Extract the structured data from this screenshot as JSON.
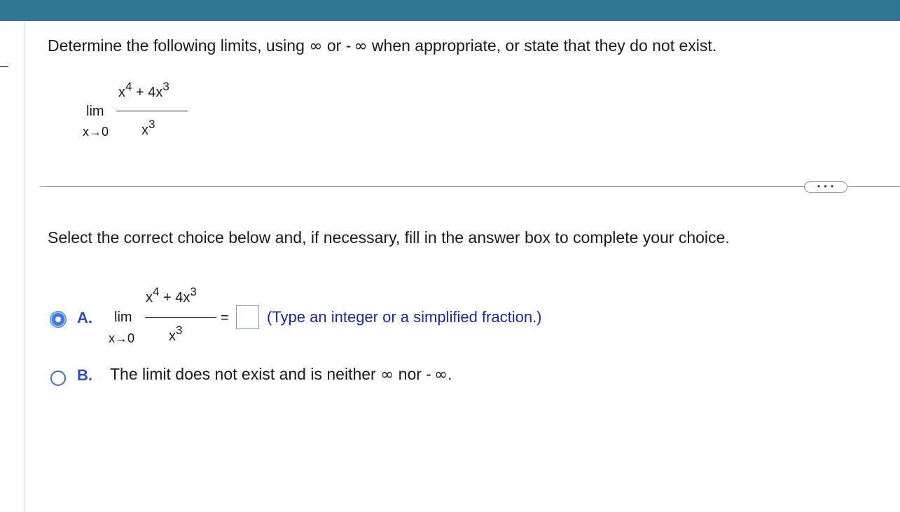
{
  "question": {
    "prefix": "Determine the following limits, using",
    "infinity": "∞",
    "or": "or",
    "minus": "-",
    "neg_infinity": "∞",
    "suffix": "when appropriate, or state that they do not exist."
  },
  "limit": {
    "lim": "lim",
    "approach": "x→0",
    "num_x": "x",
    "num_x_exp": "4",
    "num_plus": "+ 4x",
    "num_plus_exp": "3",
    "den_x": "x",
    "den_x_exp": "3"
  },
  "more_button_label": "• • •",
  "instruction": "Select the correct choice below and, if necessary, fill in the answer box to complete your choice.",
  "choices": {
    "a": {
      "letter": "A.",
      "selected": true,
      "equals": "=",
      "answer_value": "",
      "hint": "(Type an integer or a simplified fraction.)"
    },
    "b": {
      "letter": "B.",
      "selected": false,
      "text_prefix": "The limit does not exist and is neither",
      "infinity": "∞",
      "nor": "nor",
      "minus": "-",
      "neg_infinity": "∞",
      "period": "."
    }
  },
  "colors": {
    "top_bar": "#2f7795",
    "choice_letter": "#2a4fbf",
    "hint_text": "#1a2aa0",
    "radio_selected": "#3f7be0"
  }
}
